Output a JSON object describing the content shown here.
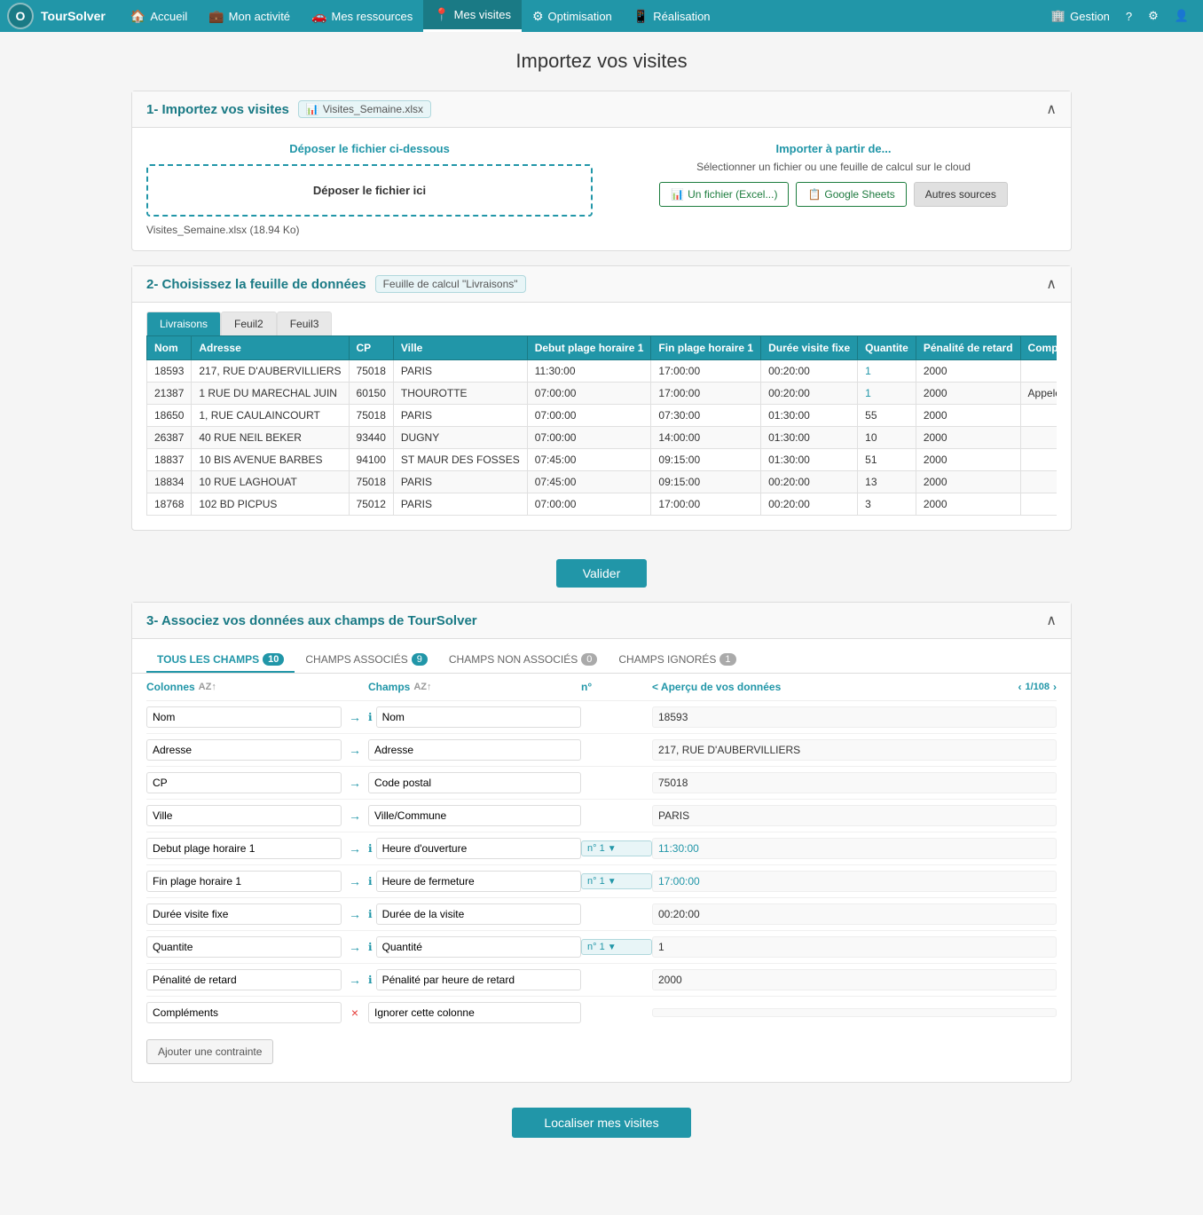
{
  "nav": {
    "logo": "O",
    "app_name": "TourSolver",
    "items": [
      {
        "label": "Accueil",
        "icon": "🏠",
        "active": false
      },
      {
        "label": "Mon activité",
        "icon": "💼",
        "active": false
      },
      {
        "label": "Mes ressources",
        "icon": "🚗",
        "active": false
      },
      {
        "label": "Mes visites",
        "icon": "📍",
        "active": true
      },
      {
        "label": "Optimisation",
        "icon": "⚙",
        "active": false
      },
      {
        "label": "Réalisation",
        "icon": "📱",
        "active": false
      }
    ],
    "right_items": [
      {
        "label": "Gestion",
        "icon": "🏢"
      },
      {
        "label": "?",
        "icon": ""
      },
      {
        "label": "⚙",
        "icon": ""
      },
      {
        "label": "👤",
        "icon": ""
      }
    ]
  },
  "page": {
    "title": "Importez vos visites"
  },
  "section1": {
    "title": "1- Importez vos visites",
    "file_badge": "Visites_Semaine.xlsx",
    "drop_title": "Déposer le fichier ci-dessous",
    "drop_label": "Déposer le fichier ici",
    "file_info": "Visites_Semaine.xlsx (18.94 Ko)",
    "cloud_title": "Importer à partir de...",
    "cloud_sub": "Sélectionner un fichier ou une feuille de calcul sur le cloud",
    "btn_excel": "Un fichier (Excel...)",
    "btn_gsheets": "Google Sheets",
    "btn_other": "Autres sources"
  },
  "section2": {
    "title": "2- Choisissez la feuille de données",
    "feuille_badge": "Feuille de calcul \"Livraisons\"",
    "tabs": [
      "Livraisons",
      "Feuil2",
      "Feuil3"
    ],
    "active_tab": 0,
    "columns": [
      "Nom",
      "Adresse",
      "CP",
      "Ville",
      "Debut plage horaire 1",
      "Fin plage horaire 1",
      "Durée visite fixe",
      "Quantite",
      "Pénalité de retard",
      "Compléments"
    ],
    "rows": [
      [
        "18593",
        "217, RUE D'AUBERVILLIERS",
        "75018",
        "PARIS",
        "11:30:00",
        "17:00:00",
        "00:20:00",
        "1",
        "2000",
        ""
      ],
      [
        "21387",
        "1 RUE DU MARECHAL JUIN",
        "60150",
        "THOUROTTE",
        "07:00:00",
        "17:00:00",
        "00:20:00",
        "1",
        "2000",
        "Appeler gérant\npour ouverture\nportail"
      ],
      [
        "18650",
        "1, RUE CAULAINCOURT",
        "75018",
        "PARIS",
        "07:00:00",
        "07:30:00",
        "01:30:00",
        "55",
        "2000",
        ""
      ],
      [
        "26387",
        "40 RUE NEIL BEKER",
        "93440",
        "DUGNY",
        "07:00:00",
        "14:00:00",
        "01:30:00",
        "10",
        "2000",
        ""
      ],
      [
        "18837",
        "10 BIS AVENUE BARBES",
        "94100",
        "ST MAUR DES FOSSES",
        "07:45:00",
        "09:15:00",
        "01:30:00",
        "51",
        "2000",
        ""
      ],
      [
        "18834",
        "10 RUE LAGHOUAT",
        "75018",
        "PARIS",
        "07:45:00",
        "09:15:00",
        "00:20:00",
        "13",
        "2000",
        ""
      ],
      [
        "18768",
        "102 BD PICPUS",
        "75012",
        "PARIS",
        "07:00:00",
        "17:00:00",
        "00:20:00",
        "3",
        "2000",
        ""
      ]
    ]
  },
  "validate_btn": "Valider",
  "section3": {
    "title": "3- Associez vos données aux champs de TourSolver",
    "tabs": [
      {
        "label": "TOUS LES CHAMPS",
        "badge": "10",
        "badge_color": "blue"
      },
      {
        "label": "CHAMPS ASSOCIÉS",
        "badge": "9",
        "badge_color": "blue"
      },
      {
        "label": "CHAMPS NON ASSOCIÉS",
        "badge": "0",
        "badge_color": "grey"
      },
      {
        "label": "CHAMPS IGNORÉS",
        "badge": "1",
        "badge_color": "grey"
      }
    ],
    "header": {
      "col_colonnes": "Colonnes",
      "col_champs": "Champs",
      "col_nr": "n°",
      "col_apercu": "< Aperçu de vos données",
      "apercu_nav": "1/108"
    },
    "rows": [
      {
        "col": "Nom",
        "arrow": "→",
        "info": true,
        "champ": "Nom",
        "nr": "",
        "apercu": "18593",
        "apercu_type": "normal"
      },
      {
        "col": "Adresse",
        "arrow": "→",
        "info": false,
        "champ": "Adresse",
        "nr": "",
        "apercu": "217, RUE D'AUBERVILLIERS",
        "apercu_type": "normal"
      },
      {
        "col": "CP",
        "arrow": "→",
        "info": false,
        "champ": "Code postal",
        "nr": "",
        "apercu": "75018",
        "apercu_type": "normal"
      },
      {
        "col": "Ville",
        "arrow": "→",
        "info": false,
        "champ": "Ville/Commune",
        "nr": "",
        "apercu": "PARIS",
        "apercu_type": "normal"
      },
      {
        "col": "Debut plage horaire 1",
        "arrow": "→",
        "info": true,
        "champ": "Heure d'ouverture",
        "nr": "n° 1",
        "apercu": "11:30:00",
        "apercu_type": "time"
      },
      {
        "col": "Fin plage horaire 1",
        "arrow": "→",
        "info": true,
        "champ": "Heure de fermeture",
        "nr": "n° 1",
        "apercu": "17:00:00",
        "apercu_type": "time"
      },
      {
        "col": "Durée visite fixe",
        "arrow": "→",
        "info": true,
        "champ": "Durée de la visite",
        "nr": "",
        "apercu": "00:20:00",
        "apercu_type": "normal"
      },
      {
        "col": "Quantite",
        "arrow": "→",
        "info": true,
        "champ": "Quantité",
        "nr": "n° 1",
        "apercu": "1",
        "apercu_type": "normal"
      },
      {
        "col": "Pénalité de retard",
        "arrow": "→",
        "info": true,
        "champ": "Pénalité par heure de retard",
        "nr": "",
        "apercu": "2000",
        "apercu_type": "normal"
      },
      {
        "col": "Compléments",
        "arrow": "×",
        "info": false,
        "champ": "Ignorer cette colonne",
        "nr": "",
        "apercu": "",
        "apercu_type": "normal"
      }
    ],
    "add_constraint_btn": "Ajouter une contrainte",
    "localize_btn": "Localiser mes visites"
  }
}
